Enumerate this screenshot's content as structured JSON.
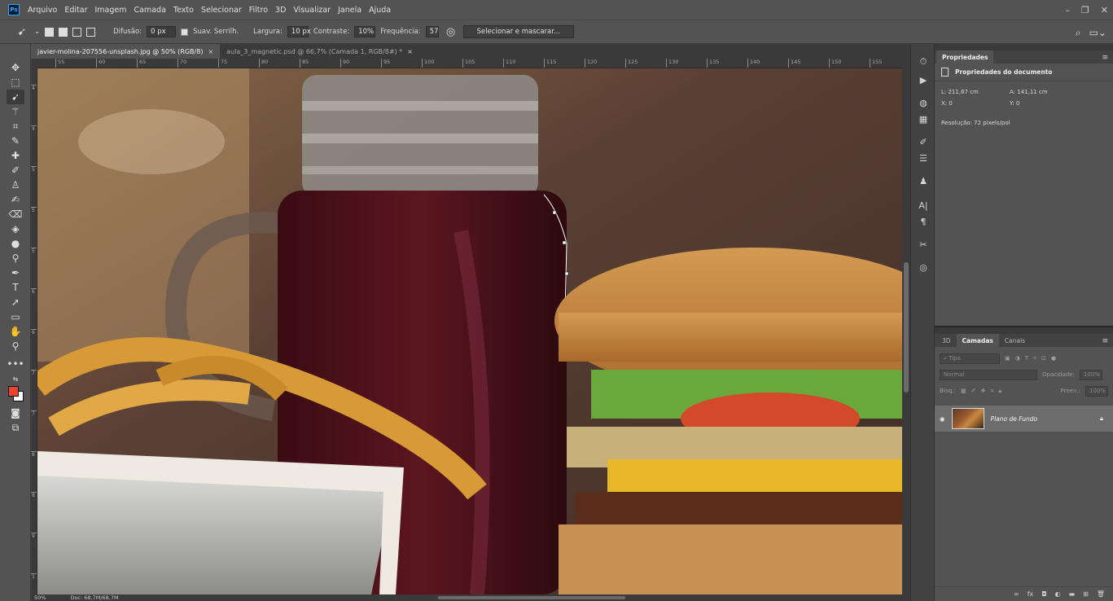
{
  "app": {
    "logo": "Ps",
    "menu": [
      "Arquivo",
      "Editar",
      "Imagem",
      "Camada",
      "Texto",
      "Selecionar",
      "Filtro",
      "3D",
      "Visualizar",
      "Janela",
      "Ajuda"
    ]
  },
  "options": {
    "feather_label": "Difusão:",
    "feather_value": "0 px",
    "antialias_label": "Suav. Serrilh.",
    "width_label": "Largura:",
    "width_value": "10 px",
    "contrast_label": "Contraste:",
    "contrast_value": "10%",
    "frequency_label": "Frequência:",
    "frequency_value": "57",
    "select_mask_label": "Selecionar e mascarar..."
  },
  "tabs": [
    {
      "label": "javier-molina-207556-unsplash.jpg @ 50% (RGB/8)",
      "close": "×"
    },
    {
      "label": "aula_3_magnetic.psd @ 66,7% (Camada 1, RGB/8#) *",
      "close": "×"
    }
  ],
  "ruler": {
    "h": [
      "55",
      "60",
      "65",
      "70",
      "75",
      "80",
      "85",
      "90",
      "95",
      "100",
      "105",
      "110",
      "115",
      "120",
      "125",
      "130",
      "135",
      "140",
      "145",
      "150",
      "155"
    ],
    "v": [
      "4",
      "4",
      "5",
      "5",
      "5",
      "6",
      "6",
      "7",
      "7",
      "8",
      "8",
      "9",
      "1"
    ]
  },
  "status": {
    "zoom": "50%",
    "doc": "Doc: 68,7M/68,7M"
  },
  "properties": {
    "tab": "Propriedades",
    "title": "Propriedades do documento",
    "width": "L: 211,67 cm",
    "height": "A: 141,11 cm",
    "x": "X: 0",
    "y": "Y: 0",
    "resolution": "Resolução: 72 pixels/pol"
  },
  "layers": {
    "tabs": [
      "3D",
      "Camadas",
      "Canais"
    ],
    "filter_placeholder": "Tipo",
    "blend_mode": "Normal",
    "opacity_label": "Opacidade:",
    "opacity_value": "100%",
    "lock_label": "Bloq.:",
    "fill_label": "Preen.:",
    "fill_value": "100%",
    "layer_name": "Plano de Fundo"
  },
  "colors": {
    "foreground": "#e8442e",
    "background": "#ffffff",
    "accent": "#31a8ff"
  }
}
